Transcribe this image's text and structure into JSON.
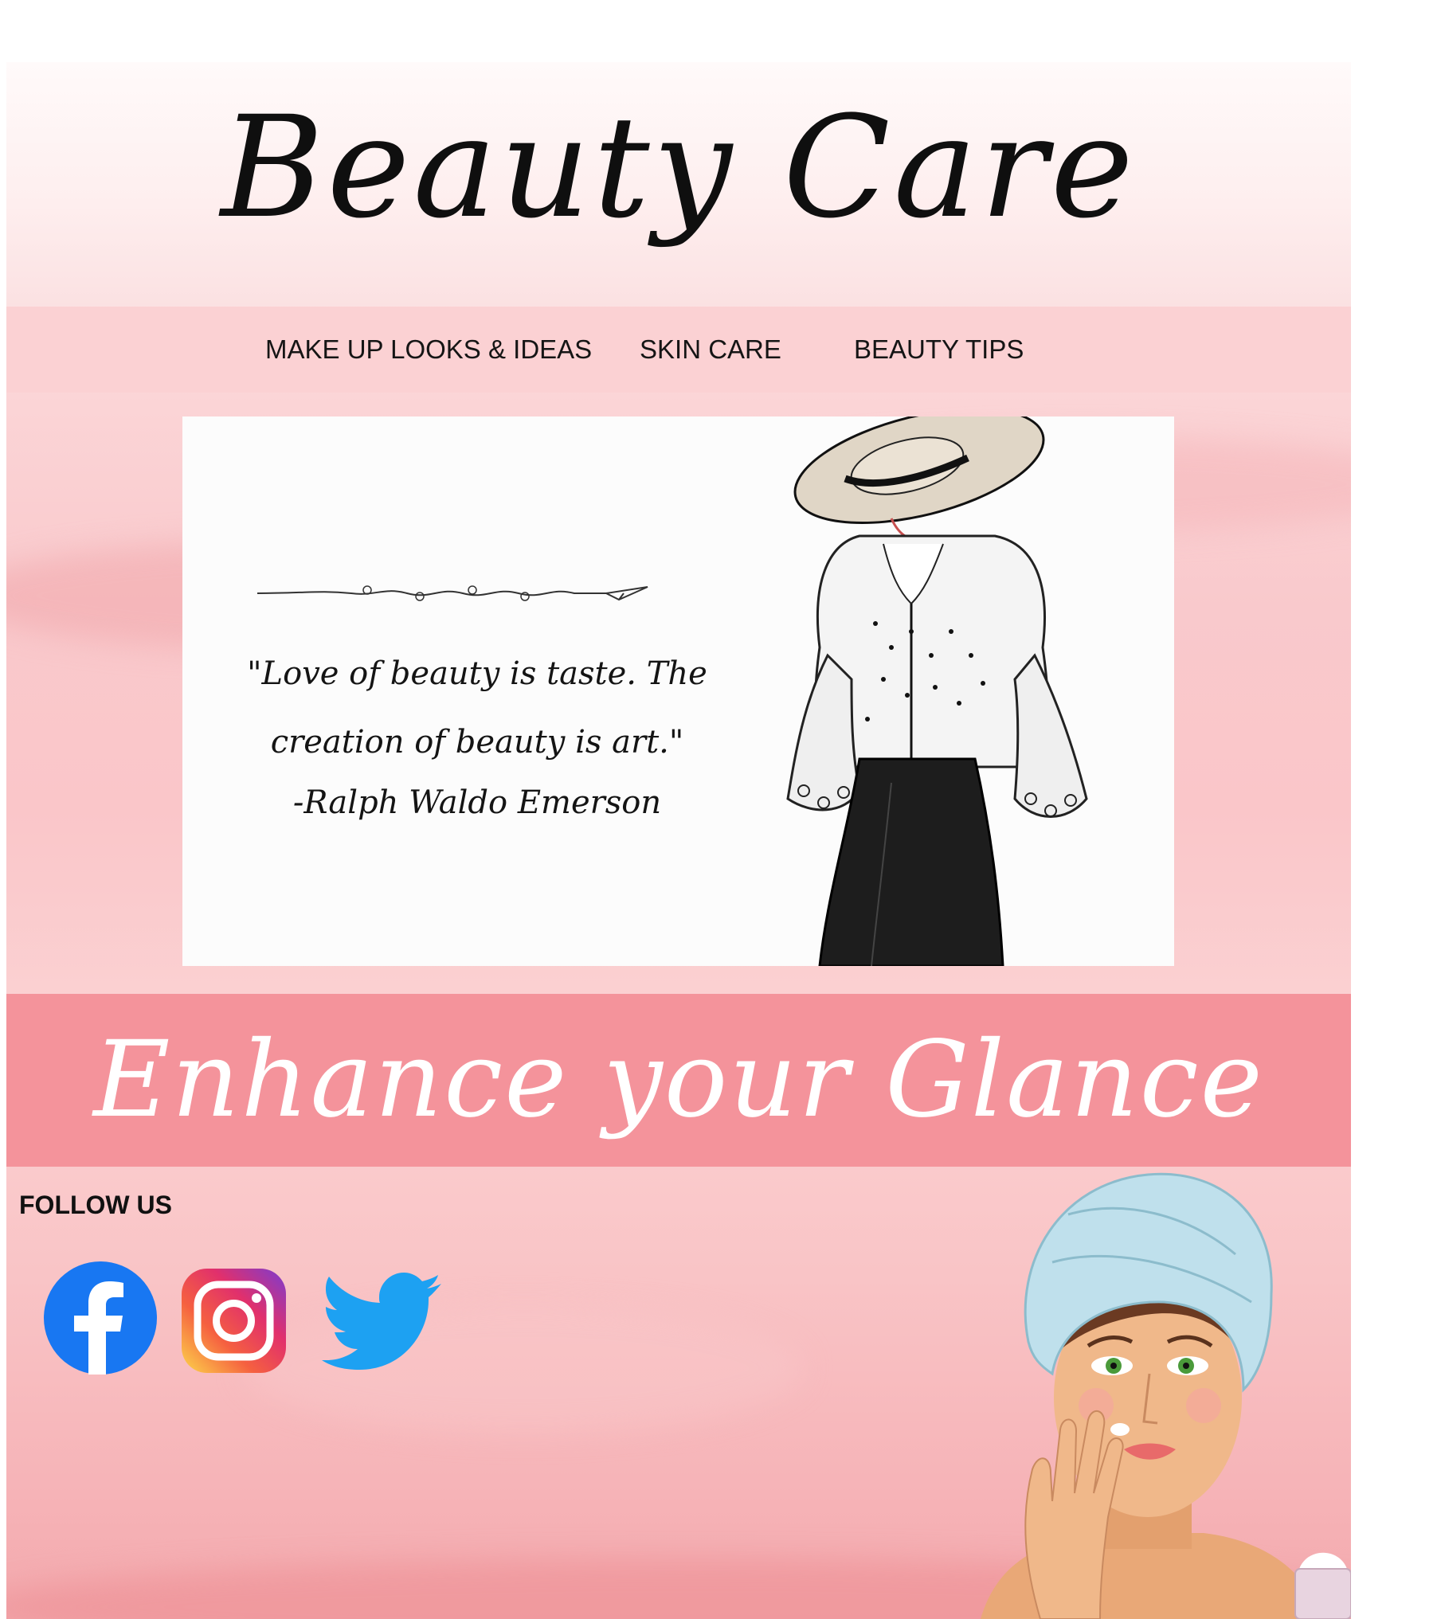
{
  "header": {
    "title": "Beauty Care"
  },
  "nav": {
    "items": [
      {
        "label": "MAKE UP LOOKS & IDEAS"
      },
      {
        "label": "SKIN CARE"
      },
      {
        "label": "BEAUTY TIPS"
      }
    ]
  },
  "hero": {
    "quote": "\"Love of beauty is taste. The creation of beauty is art.\"",
    "author": "-Ralph Waldo Emerson"
  },
  "banner": {
    "text": "Enhance your Glance"
  },
  "social": {
    "heading": "FOLLOW US",
    "icons": [
      "facebook-icon",
      "instagram-icon",
      "twitter-icon"
    ]
  },
  "colors": {
    "nav_band": "#fbd1d3",
    "banner": "#f4939b",
    "facebook": "#1877f2",
    "twitter": "#1da1f2"
  }
}
